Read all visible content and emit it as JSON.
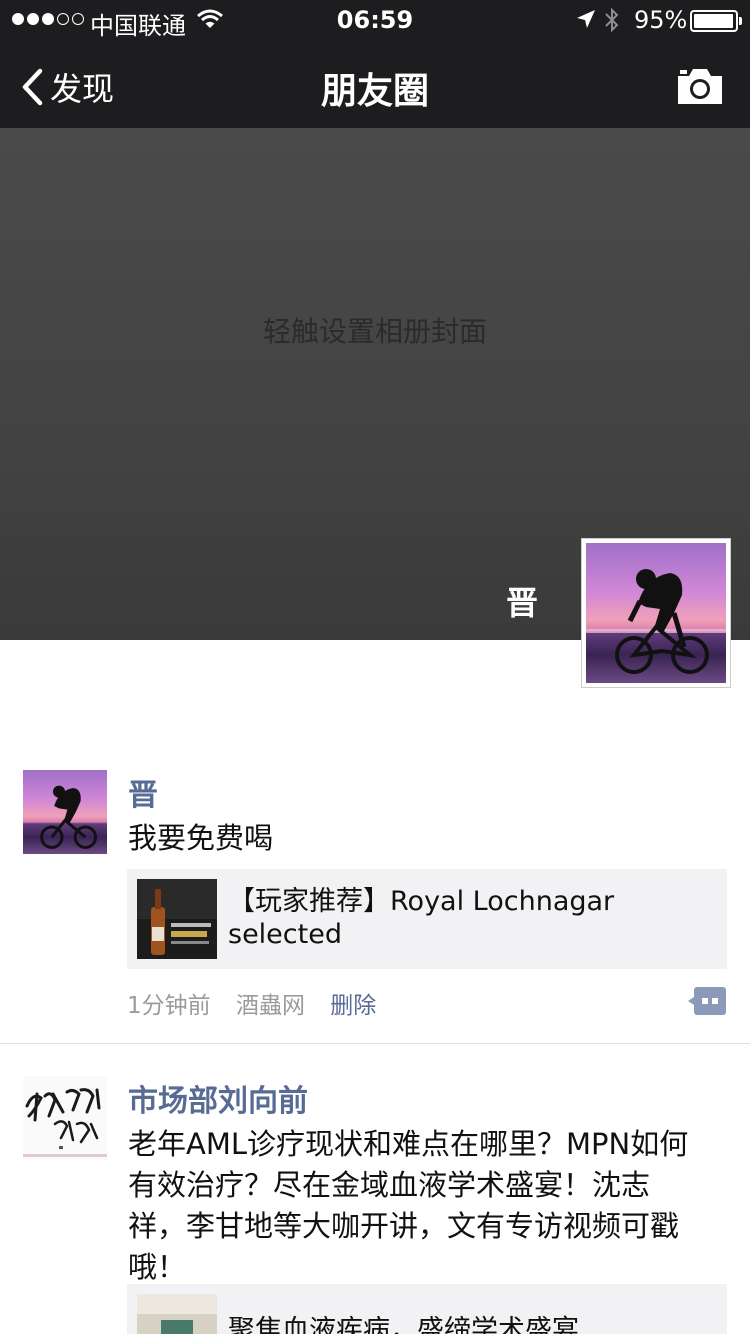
{
  "status_bar": {
    "carrier": "中国联通",
    "time": "06:59",
    "battery": "95%",
    "battery_level": 0.95
  },
  "nav": {
    "back_label": "发现",
    "title": "朋友圈"
  },
  "cover": {
    "hint": "轻触设置相册封面",
    "user_name": "晋"
  },
  "posts": [
    {
      "author": "晋",
      "text": "我要免费喝",
      "link_title": "【玩家推荐】Royal Lochnagar selected",
      "time": "1分钟前",
      "source": "酒蟲网",
      "delete_label": "删除"
    },
    {
      "author": "市场部刘向前",
      "text": "老年AML诊疗现状和难点在哪里？MPN如何有效治疗？尽在金域血液学术盛宴！沈志祥，李甘地等大咖开讲，文有专访视频可戳哦！",
      "link_title": "聚焦血液疾病，盛缔学术盛宴"
    }
  ],
  "icons": {
    "back": "chevron-left-icon",
    "camera": "camera-icon",
    "wifi": "wifi-icon",
    "location": "location-arrow-icon",
    "bluetooth": "bluetooth-icon",
    "comment": "comment-more-icon"
  },
  "colors": {
    "nav_bg": "#1d1d1f",
    "name_link": "#576b95",
    "card_bg": "#f2f2f4",
    "meta_gray": "#9b9b9b"
  }
}
